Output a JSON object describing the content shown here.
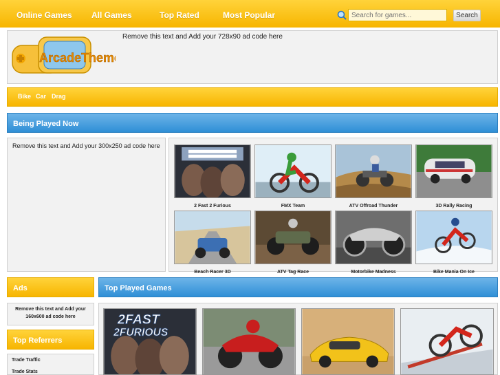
{
  "nav": {
    "items": [
      "Online Games",
      "All Games",
      "Top Rated",
      "Most Popular"
    ],
    "search_placeholder": "Search for games...",
    "search_button": "Search"
  },
  "header": {
    "logo_text": "ArcadeTheme",
    "ad_text": "Remove this text and Add your 728x90 ad code here"
  },
  "categories": [
    "Bike",
    "Car",
    "Drag"
  ],
  "being_played": {
    "heading": "Being Played Now",
    "ad_text": "Remove this text and Add your 300x250 ad code here",
    "games": [
      "2 Fast 2 Furious",
      "FMX Team",
      "ATV Offroad Thunder",
      "3D Rally Racing",
      "Beach Racer 3D",
      "ATV Tag Race",
      "Motorbike Madness",
      "Bike Mania On Ice"
    ]
  },
  "sidebar": {
    "ads_heading": "Ads",
    "ads_text": "Remove this text and Add your 160x600 ad code here",
    "referrers_heading": "Top Referrers",
    "referrers": [
      "Trade Traffic",
      "Trade Stats"
    ]
  },
  "top_played": {
    "heading": "Top Played Games",
    "thumb_text": [
      "2FAST",
      "2FURIOUS"
    ]
  },
  "colors": {
    "yellow": "#f7b500",
    "blue": "#2f8fd6",
    "panel": "#f2f2f2"
  }
}
